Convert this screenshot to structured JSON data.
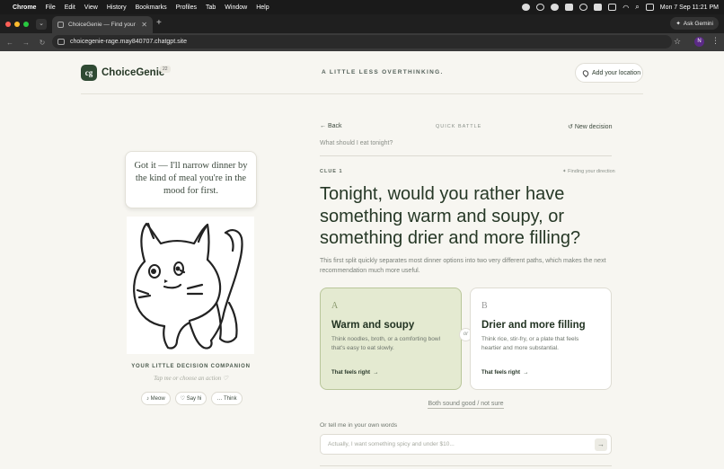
{
  "menubar": {
    "app": "Chrome",
    "items": [
      "File",
      "Edit",
      "View",
      "History",
      "Bookmarks",
      "Profiles",
      "Tab",
      "Window",
      "Help"
    ],
    "clock": "Mon 7 Sep  11:21 PM"
  },
  "browser": {
    "tab_title": "ChoiceGenie — Find your cle",
    "url": "choicegenie-rage.may840707.chatgpt.site",
    "gemini_label": "Ask Gemini",
    "profile_initial": "N"
  },
  "header": {
    "logo_mark": "cg",
    "logo_text": "ChoiceGenie",
    "logo_badge": "22",
    "tagline": "A LITTLE LESS OVERTHINKING.",
    "location_label": "Add your location"
  },
  "companion": {
    "speech": "Got it — I'll narrow dinner by the kind of meal you're in the mood for first.",
    "title": "YOUR LITTLE DECISION COMPANION",
    "hint": "Tap me or choose an action ♡",
    "actions": [
      "♪ Meow",
      "♡ Say hi",
      "… Think"
    ]
  },
  "battle": {
    "back_label": "Back",
    "mode_label": "QUICK BATTLE",
    "new_decision_label": "New decision",
    "question": "What should I eat tonight?",
    "clue_label": "CLUE 1",
    "finding_label": "Finding your direction",
    "headline": "Tonight, would you rather have something warm and soupy, or something drier and more filling?",
    "subtext": "This first split quickly separates most dinner options into two very different paths, which makes the next recommendation much more useful.",
    "or_label": "or",
    "option_a": {
      "letter": "A",
      "title": "Warm and soupy",
      "description": "Think noodles, broth, or a comforting bowl that's easy to eat slowly.",
      "cta": "That feels right"
    },
    "option_b": {
      "letter": "B",
      "title": "Drier and more filling",
      "description": "Think rice, stir-fry, or a plate that feels heartier and more substantial.",
      "cta": "That feels right"
    },
    "both_label": "Both sound good / not sure",
    "own_words_label": "Or tell me in your own words",
    "own_words_placeholder": "Actually, I want something spicy and under $10..."
  }
}
